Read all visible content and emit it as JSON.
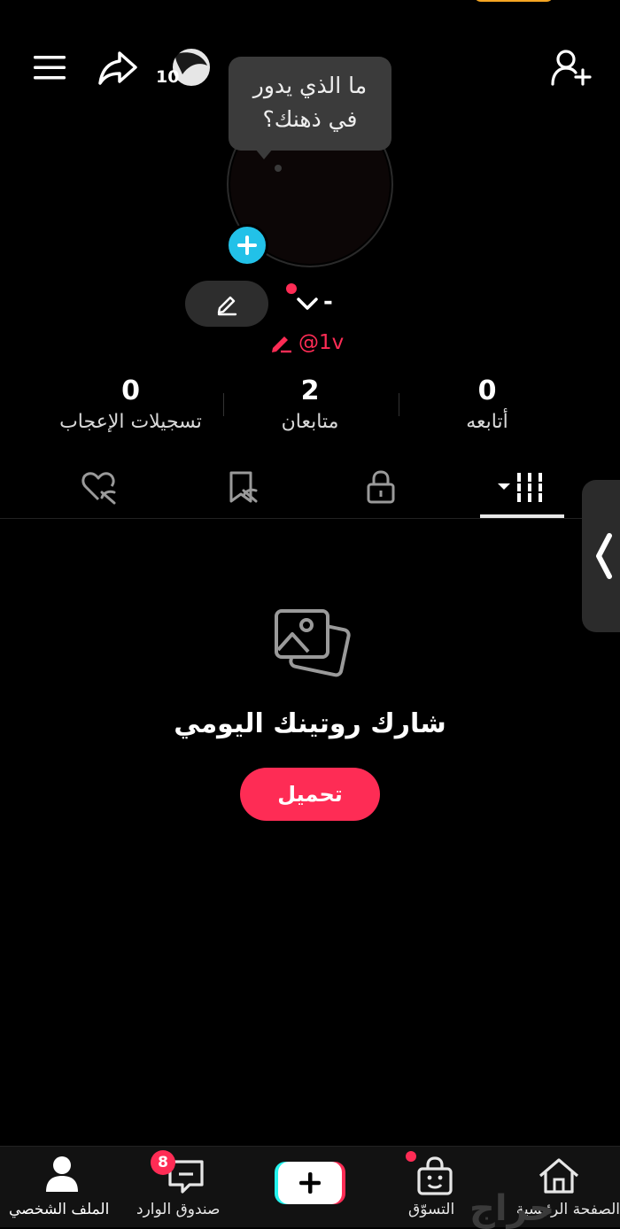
{
  "header": {
    "menu_icon": "hamburger-icon",
    "share_icon": "share-arrow-icon",
    "story_count": "10",
    "add_friend_icon": "add-user-icon"
  },
  "tooltip": {
    "line1": "ما الذي يدور",
    "line2": "في ذهنك؟"
  },
  "profile": {
    "name": "-",
    "handle": "@1v"
  },
  "stats": [
    {
      "value": "0",
      "label": "أتابعه"
    },
    {
      "value": "2",
      "label": "متابعان"
    },
    {
      "value": "0",
      "label": "تسجيلات الإعجاب"
    }
  ],
  "tabs": [
    {
      "icon": "grid-videos-icon",
      "active": true
    },
    {
      "icon": "lock-icon",
      "active": false
    },
    {
      "icon": "bookmark-hidden-icon",
      "active": false
    },
    {
      "icon": "heart-hidden-icon",
      "active": false
    }
  ],
  "empty_state": {
    "icon": "photos-icon",
    "title": "شارك روتينك اليومي",
    "button": "تحميل"
  },
  "bottom_nav": {
    "home": "الصفحة الرئيسية",
    "shop": "التسوّق",
    "inbox": "صندوق الوارد",
    "inbox_badge": "8",
    "profile": "الملف الشخصي"
  },
  "watermark": "حراج",
  "colors": {
    "accent": "#fe2c55",
    "plus_badge": "#22c1e8",
    "background": "#000000"
  }
}
